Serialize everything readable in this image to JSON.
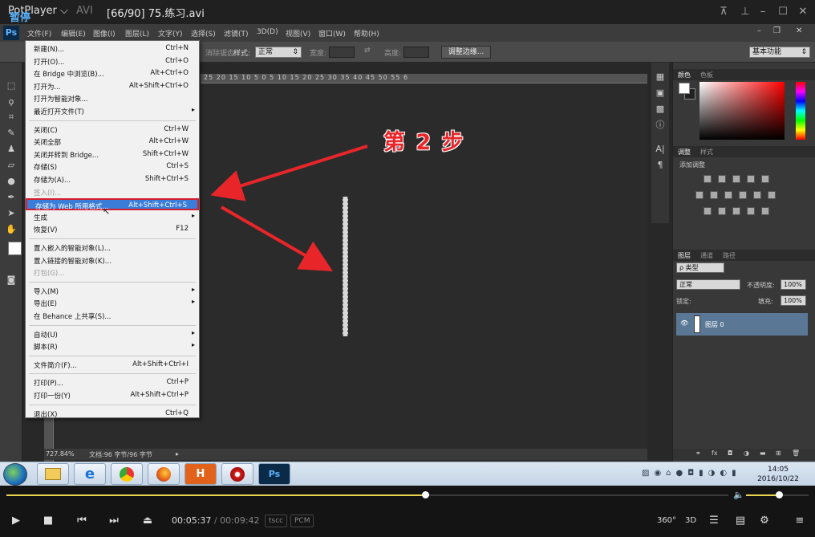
{
  "player": {
    "brand": "PotPlayer ⌵",
    "format": "AVI",
    "file_title": "[66/90] 75.练习.avi",
    "pause_label": "暂停",
    "time_current": "00:05:37",
    "time_sep": "/",
    "time_total": "00:09:42",
    "tag_codec": "tscc",
    "tag_audio": "PCM",
    "seek_progress": 0.58,
    "volume_level": 0.52,
    "btn_360": "360°",
    "btn_3d": "3D"
  },
  "ps": {
    "menus": [
      "文件(F)",
      "编辑(E)",
      "图像(I)",
      "图层(L)",
      "文字(Y)",
      "选择(S)",
      "滤镜(T)",
      "3D(D)",
      "视图(V)",
      "窗口(W)",
      "帮助(H)"
    ],
    "options": {
      "feather_label": "消除锯齿",
      "style_label": "样式:",
      "style_value": "正常",
      "width_label": "宽度:",
      "height_label": "高度:",
      "refine_button": "调整边缘...",
      "workspace": "基本功能"
    },
    "ruler_ticks": "25  20  15  10  5  0  5  10  15  20  25  30  35  40  45  50  55  6",
    "status_zoom": "727.84%",
    "status_doc": "文档:96 字节/96 字节",
    "panels": {
      "color_tab": "颜色",
      "swatch_tab": "色板",
      "adjust_tab": "调整",
      "style_tab": "样式",
      "add_adjust": "添加调整",
      "layers_tab": "图层",
      "channels_tab": "通道",
      "paths_tab": "路径",
      "kind_filter": "ρ 类型",
      "blend_mode": "正常",
      "opacity_label": "不透明度:",
      "opacity_value": "100%",
      "lock_label": "锁定:",
      "fill_label": "填充:",
      "fill_value": "100%",
      "layer_name": "图层 0"
    }
  },
  "annotation": "第 2 步",
  "file_menu": [
    {
      "label": "新建(N)...",
      "shortcut": "Ctrl+N"
    },
    {
      "label": "打开(O)...",
      "shortcut": "Ctrl+O"
    },
    {
      "label": "在 Bridge 中浏览(B)...",
      "shortcut": "Alt+Ctrl+O"
    },
    {
      "label": "打开为...",
      "shortcut": "Alt+Shift+Ctrl+O"
    },
    {
      "label": "打开为智能对象...",
      "shortcut": ""
    },
    {
      "label": "最近打开文件(T)",
      "shortcut": "",
      "submenu": true
    },
    {
      "sep": true
    },
    {
      "label": "关闭(C)",
      "shortcut": "Ctrl+W"
    },
    {
      "label": "关闭全部",
      "shortcut": "Alt+Ctrl+W"
    },
    {
      "label": "关闭并转到 Bridge...",
      "shortcut": "Shift+Ctrl+W"
    },
    {
      "label": "存储(S)",
      "shortcut": "Ctrl+S"
    },
    {
      "label": "存储为(A)...",
      "shortcut": "Shift+Ctrl+S"
    },
    {
      "label": "签入(I)...",
      "shortcut": "",
      "disabled": true
    },
    {
      "label": "存储为 Web 所用格式...",
      "shortcut": "Alt+Shift+Ctrl+S",
      "highlight": true
    },
    {
      "label": "生成",
      "shortcut": "",
      "submenu": true
    },
    {
      "label": "恢复(V)",
      "shortcut": "F12"
    },
    {
      "sep": true
    },
    {
      "label": "置入嵌入的智能对象(L)...",
      "shortcut": ""
    },
    {
      "label": "置入链接的智能对象(K)...",
      "shortcut": ""
    },
    {
      "label": "打包(G)...",
      "shortcut": "",
      "disabled": true
    },
    {
      "sep": true
    },
    {
      "label": "导入(M)",
      "shortcut": "",
      "submenu": true
    },
    {
      "label": "导出(E)",
      "shortcut": "",
      "submenu": true
    },
    {
      "label": "在 Behance 上共享(S)...",
      "shortcut": ""
    },
    {
      "sep": true
    },
    {
      "label": "自动(U)",
      "shortcut": "",
      "submenu": true
    },
    {
      "label": "脚本(R)",
      "shortcut": "",
      "submenu": true
    },
    {
      "sep": true
    },
    {
      "label": "文件简介(F)...",
      "shortcut": "Alt+Shift+Ctrl+I"
    },
    {
      "sep": true
    },
    {
      "label": "打印(P)...",
      "shortcut": "Ctrl+P"
    },
    {
      "label": "打印一份(Y)",
      "shortcut": "Alt+Shift+Ctrl+P"
    },
    {
      "sep": true
    },
    {
      "label": "退出(X)",
      "shortcut": "Ctrl+Q"
    }
  ],
  "taskbar": {
    "clock_time": "14:05",
    "clock_date": "2016/10/22",
    "apps": [
      "windows-explorer-icon",
      "internet-explorer-icon",
      "chrome-icon",
      "firefox-icon",
      "hbuilder-icon",
      "media-player-icon",
      "photoshop-icon"
    ],
    "app_labels": {
      "hbuilder": "H",
      "ps": "Ps"
    }
  },
  "colors": {
    "accent": "#e8262a",
    "menu_highlight": "#3a7dd8",
    "seek": "#e8d44d"
  }
}
